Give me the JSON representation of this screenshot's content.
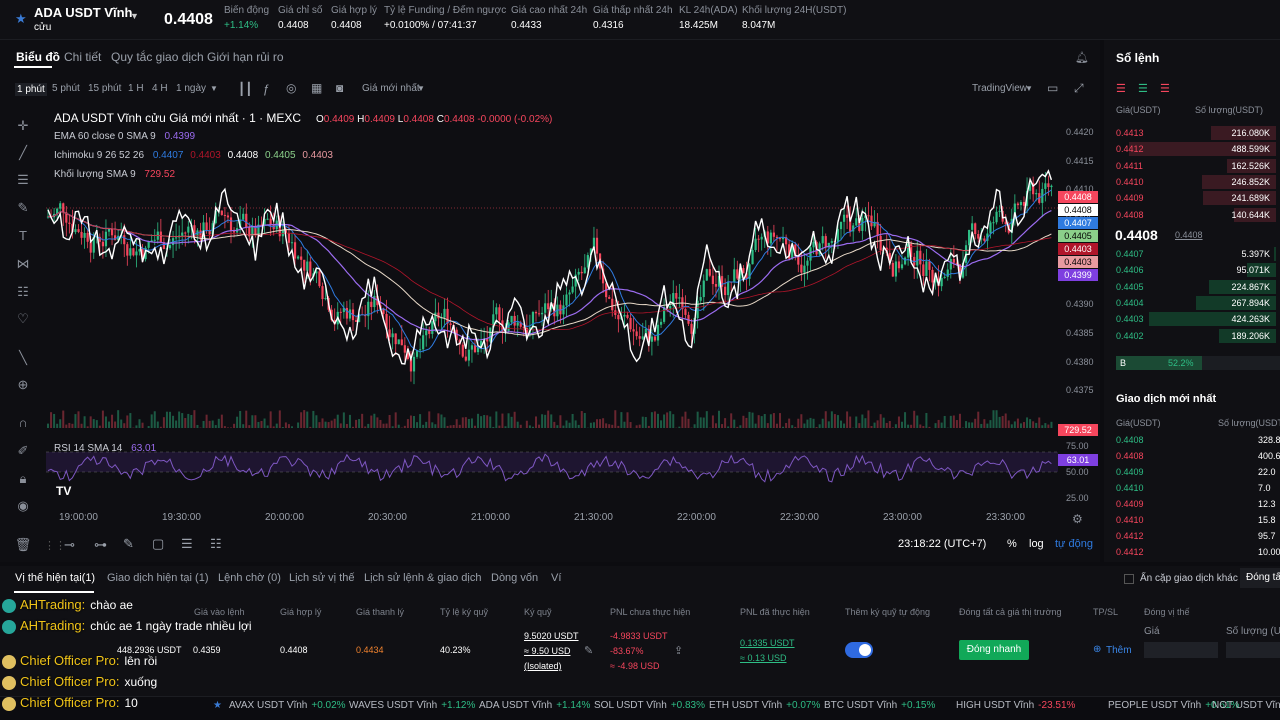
{
  "header": {
    "symbol": "ADA USDT Vĩnh",
    "symbol_sub": "cửu",
    "price": "0.4408",
    "stats": [
      {
        "label": "Biến động",
        "value": "+1.14%",
        "color": "#2ebd85"
      },
      {
        "label": "Giá chỉ số",
        "value": "0.4408"
      },
      {
        "label": "Giá hợp lý",
        "value": "0.4408"
      },
      {
        "label": "Tỷ lệ Funding / Đếm ngược",
        "value": "+0.0100% / 07:41:37"
      },
      {
        "label": "Giá cao nhất 24h",
        "value": "0.4433"
      },
      {
        "label": "Giá thấp nhất 24h",
        "value": "0.4316"
      },
      {
        "label": "KL 24h(ADA)",
        "value": "18.425M"
      },
      {
        "label": "Khối lượng 24H(USDT)",
        "value": "8.047M"
      }
    ]
  },
  "chart_tabs": [
    "Biểu đồ",
    "Chi tiết",
    "Quy tắc giao dịch",
    "Giới hạn rủi ro"
  ],
  "timeframes": [
    "1 phút",
    "5 phút",
    "15 phút",
    "1 H",
    "4 H",
    "1 ngày"
  ],
  "toolbar": {
    "price_type": "Giá mới nhất",
    "provider": "TradingView"
  },
  "legend": {
    "title": "ADA USDT Vĩnh cửu Giá mới nhất · 1 · MEXC",
    "o": "0.4409",
    "h": "0.4409",
    "l": "0.4408",
    "c": "0.4408",
    "chg": "-0.0000 (-0.02%)",
    "ema": "EMA 60 close 0 SMA 9",
    "ema_v": "0.4399",
    "ichi": "Ichimoku 9 26 52 26",
    "ichi_v": [
      "0.4407",
      "0.4403",
      "0.4408",
      "0.4405",
      "0.4403"
    ],
    "vol": "Khối lượng SMA 9",
    "vol_v": "729.52",
    "rsi": "RSI 14 SMA 14",
    "rsi_v": "63.01"
  },
  "price_axis": [
    "0.4420",
    "0.4415",
    "0.4410",
    "0.4405",
    "0.4400",
    "0.4395",
    "0.4390",
    "0.4385",
    "0.4380",
    "0.4375"
  ],
  "price_tags": [
    {
      "v": "0.4408",
      "bg": "#f6465d",
      "fg": "#fff"
    },
    {
      "v": "0.4408",
      "bg": "#ffffff",
      "fg": "#000"
    },
    {
      "v": "0.4407",
      "bg": "#2f7be0",
      "fg": "#fff"
    },
    {
      "v": "0.4405",
      "bg": "#8bd08a",
      "fg": "#000"
    },
    {
      "v": "0.4403",
      "bg": "#b0152a",
      "fg": "#fff"
    },
    {
      "v": "0.4403",
      "bg": "#e89aa0",
      "fg": "#000"
    },
    {
      "v": "0.4399",
      "bg": "#7e3fe0",
      "fg": "#fff"
    }
  ],
  "vol_tag": "729.52",
  "rsi_axis": [
    "75.00",
    "50.00",
    "25.00"
  ],
  "time_axis": [
    "19:00:00",
    "19:30:00",
    "20:00:00",
    "20:30:00",
    "21:00:00",
    "21:30:00",
    "22:00:00",
    "22:30:00",
    "23:00:00",
    "23:30:00"
  ],
  "status": {
    "clock": "23:18:22 (UTC+7)",
    "pct": "%",
    "log": "log",
    "auto": "tự động"
  },
  "orderbook": {
    "title": "Sổ lệnh",
    "col_price": "Giá(USDT)",
    "col_qty": "Số lượng(USDT)",
    "asks": [
      [
        "0.4413",
        "216.080K"
      ],
      [
        "0.4412",
        "488.599K"
      ],
      [
        "0.4411",
        "162.526K"
      ],
      [
        "0.4410",
        "246.852K"
      ],
      [
        "0.4409",
        "241.689K"
      ],
      [
        "0.4408",
        "140.644K"
      ]
    ],
    "last": "0.4408",
    "mark": "0.4408",
    "bids": [
      [
        "0.4407",
        "5.397K"
      ],
      [
        "0.4406",
        "95.071K"
      ],
      [
        "0.4405",
        "224.867K"
      ],
      [
        "0.4404",
        "267.894K"
      ],
      [
        "0.4403",
        "424.263K"
      ],
      [
        "0.4402",
        "189.206K"
      ]
    ],
    "ratio_label": "B",
    "ratio": "52.2%"
  },
  "trades": {
    "title": "Giao dịch mới nhất",
    "col_price": "Giá(USDT)",
    "col_qty": "Số lượng(USDT)",
    "rows": [
      [
        "0.4408",
        "328.8",
        "g"
      ],
      [
        "0.4408",
        "400.6",
        "r"
      ],
      [
        "0.4409",
        "22.0",
        "g"
      ],
      [
        "0.4410",
        "7.0",
        "g"
      ],
      [
        "0.4409",
        "12.3",
        "r"
      ],
      [
        "0.4410",
        "15.8",
        "r"
      ],
      [
        "0.4412",
        "95.7",
        "r"
      ],
      [
        "0.4412",
        "10.000",
        "r"
      ]
    ]
  },
  "bottom": {
    "tabs": [
      "Vị thế hiện tại(1)",
      "Giao dịch hiện tại (1)",
      "Lệnh chờ (0)",
      "Lịch sử vị thế",
      "Lịch sử lệnh & giao dịch",
      "Dòng vốn",
      "Ví"
    ],
    "hide_other": "Ẩn cặp giao dịch khác",
    "close_all": "Đóng tấ",
    "headers": [
      "Giá vào lệnh",
      "Giá hợp lý",
      "Giá thanh lý",
      "Tỷ lệ ký quỹ",
      "Ký quỹ",
      "PNL chưa thực hiện",
      "PNL đã thực hiện",
      "Thêm ký quỹ tự động",
      "Đóng tất cả giá thị trường",
      "TP/SL",
      "Đóng vị thế"
    ],
    "row": {
      "size": "448.2936 USDT",
      "entry": "0.4359",
      "fair": "0.4408",
      "liq": "0.4434",
      "ratio": "40.23%",
      "margin1": "9.5020 USDT",
      "margin2": "≈ 9.50 USD",
      "margin3": "(Isolated)",
      "upnl1": "-4.9833 USDT",
      "upnl2": "-83.67%",
      "upnl3": "≈ -4.98 USD",
      "rpnl1": "0.1335 USDT",
      "rpnl2": "≈ 0.13 USD",
      "close_btn": "Đóng nhanh",
      "add": "Thêm",
      "price_lbl": "Giá",
      "qty_lbl": "Số lượng (US"
    }
  },
  "chat": [
    {
      "name": "AHTrading:",
      "text": "chào ae",
      "color": "#26a69a"
    },
    {
      "name": "AHTrading:",
      "text": "chúc ae 1 ngày trade nhiều lợi",
      "color": "#26a69a"
    },
    {
      "name": "Chief Officer Pro:",
      "text": "lên rồi",
      "color": "#e0c060"
    },
    {
      "name": "Chief Officer Pro:",
      "text": "xuống",
      "color": "#e0c060"
    },
    {
      "name": "Chief Officer Pro:",
      "text": "10",
      "color": "#e0c060"
    }
  ],
  "ticker": [
    {
      "s": "AVAX USDT Vĩnh",
      "c": "+0.02%",
      "col": "#2ebd85"
    },
    {
      "s": "WAVES USDT Vĩnh",
      "c": "+1.12%",
      "col": "#2ebd85"
    },
    {
      "s": "ADA USDT Vĩnh",
      "c": "+1.14%",
      "col": "#2ebd85"
    },
    {
      "s": "SOL USDT Vĩnh",
      "c": "+0.83%",
      "col": "#2ebd85"
    },
    {
      "s": "ETH USDT Vĩnh",
      "c": "+0.07%",
      "col": "#2ebd85"
    },
    {
      "s": "BTC USDT Vĩnh",
      "c": "+0.15%",
      "col": "#2ebd85"
    },
    {
      "s": "HIGH USDT Vĩnh",
      "c": "-23.51%",
      "col": "#f6465d"
    },
    {
      "s": "PEOPLE USDT Vĩnh",
      "c": "+0.61%",
      "col": "#2ebd85"
    },
    {
      "s": "NOT USDT Vĩnh",
      "c": "",
      "col": "#2ebd85"
    }
  ]
}
